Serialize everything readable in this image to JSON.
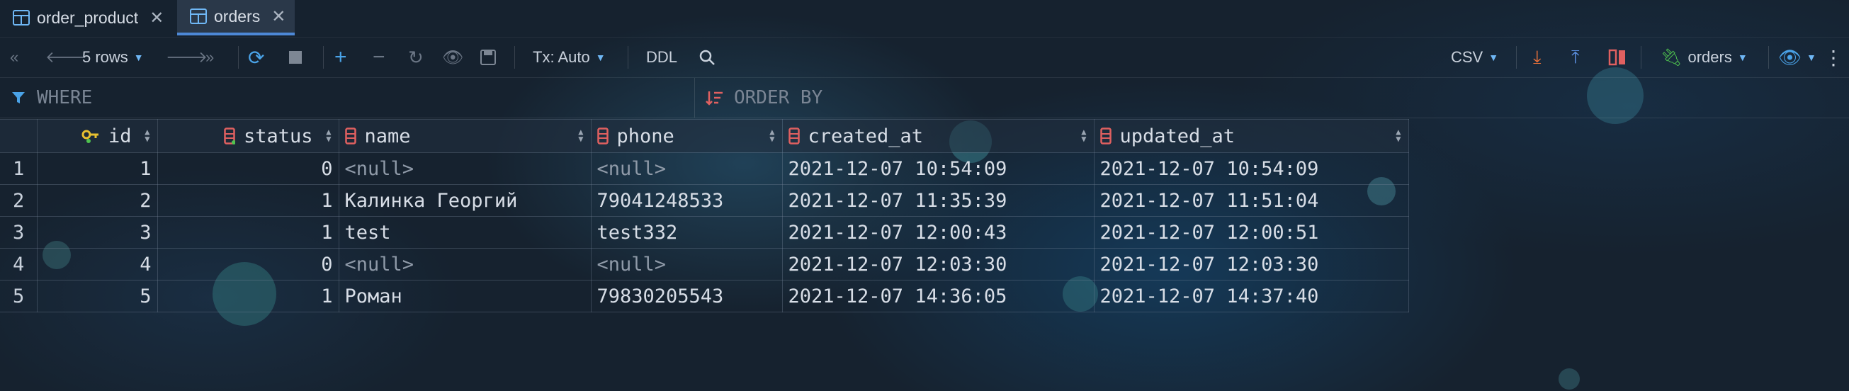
{
  "tabs": [
    {
      "label": "order_product",
      "active": false
    },
    {
      "label": "orders",
      "active": true
    }
  ],
  "toolbar": {
    "rows_label": "5 rows",
    "tx_label": "Tx: Auto",
    "ddl_label": "DDL",
    "export_format": "CSV",
    "datasource_label": "orders"
  },
  "filter": {
    "where_label": "WHERE",
    "order_by_label": "ORDER BY"
  },
  "grid": {
    "columns": [
      {
        "label": "id",
        "icon": "key-icon"
      },
      {
        "label": "status",
        "icon": "column-icon"
      },
      {
        "label": "name",
        "icon": "column-icon"
      },
      {
        "label": "phone",
        "icon": "column-icon"
      },
      {
        "label": "created_at",
        "icon": "column-icon"
      },
      {
        "label": "updated_at",
        "icon": "column-icon"
      }
    ],
    "rows": [
      {
        "n": "1",
        "id": "1",
        "status": "0",
        "name": "<null>",
        "phone": "<null>",
        "created_at": "2021-12-07 10:54:09",
        "updated_at": "2021-12-07 10:54:09"
      },
      {
        "n": "2",
        "id": "2",
        "status": "1",
        "name": "Калинка Георгий",
        "phone": "79041248533",
        "created_at": "2021-12-07 11:35:39",
        "updated_at": "2021-12-07 11:51:04"
      },
      {
        "n": "3",
        "id": "3",
        "status": "1",
        "name": "test",
        "phone": "test332",
        "created_at": "2021-12-07 12:00:43",
        "updated_at": "2021-12-07 12:00:51"
      },
      {
        "n": "4",
        "id": "4",
        "status": "0",
        "name": "<null>",
        "phone": "<null>",
        "created_at": "2021-12-07 12:03:30",
        "updated_at": "2021-12-07 12:03:30"
      },
      {
        "n": "5",
        "id": "5",
        "status": "1",
        "name": "Роман",
        "phone": "79830205543",
        "created_at": "2021-12-07 14:36:05",
        "updated_at": "2021-12-07 14:37:40"
      }
    ]
  },
  "colors": {
    "accent": "#4d88d6",
    "add": "#4aa3e8",
    "download": "#e8703a",
    "upload": "#5b8fe0",
    "datasource_plug": "#4fc24f",
    "column_icon": "#e06060",
    "key": "#e8c030"
  }
}
